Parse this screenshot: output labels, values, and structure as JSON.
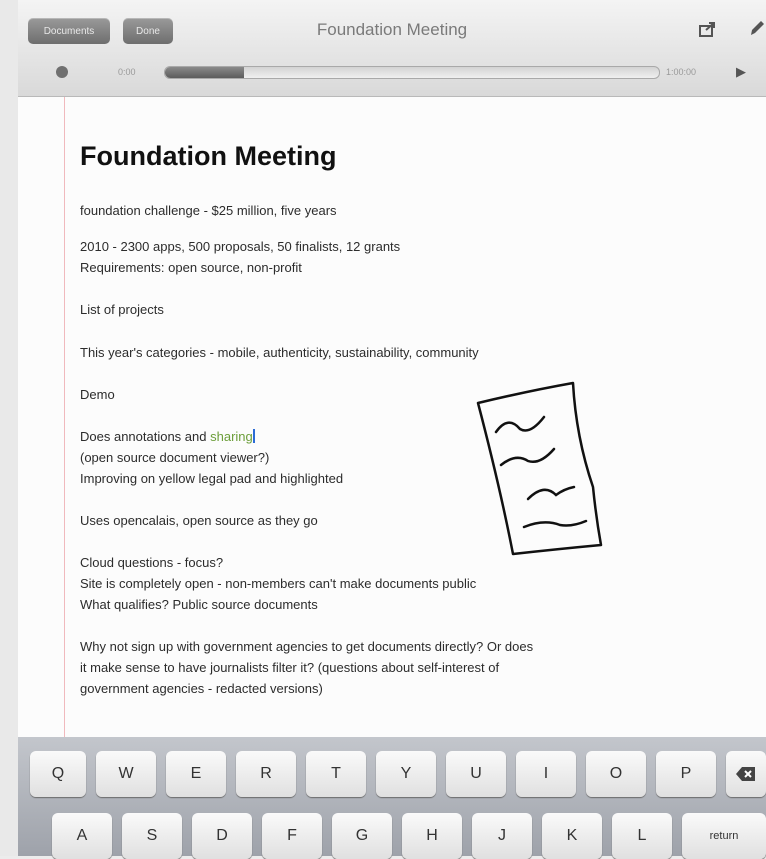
{
  "toolbar": {
    "title": "Foundation Meeting",
    "left_buttons": [
      "Documents",
      "Done"
    ],
    "share_icon": "share-icon",
    "pen_icon": "pen-icon",
    "play_icon": "play-icon",
    "elapsed": "0:00",
    "remaining": "1:00:00",
    "playback_progress": 0.16
  },
  "document": {
    "title": "Foundation Meeting",
    "lines": [
      {
        "text": "foundation challenge - $25 million, five years"
      },
      {
        "text": "2010 - 2300 apps, 500 proposals, 50 finalists, 12 grants"
      },
      {
        "text": "Requirements: open source, non-profit"
      },
      {
        "text": "List of projects"
      },
      {
        "text": "This year's categories - mobile, authenticity, sustainability, community"
      },
      {
        "text": "Demo"
      },
      {
        "text": "Does annotations and ",
        "highlight": "sharing"
      },
      {
        "text": "(open source document viewer?)"
      },
      {
        "text": "Improving on yellow legal pad and highlighted"
      },
      {
        "text": "Uses opencalais, open source as they go"
      },
      {
        "text": "Cloud questions - focus?"
      },
      {
        "text": "Site is completely open - non-members can't make documents public"
      },
      {
        "text": "What qualifies? Public source documents"
      },
      {
        "text": "Why not sign up with government agencies to get documents directly? Or does"
      },
      {
        "text": "it make sense to have journalists filter it? (questions about self-interest of"
      },
      {
        "text": "government agencies - redacted versions)"
      }
    ],
    "sketch_icon": "document-sketch-icon"
  },
  "keyboard": {
    "row1": [
      "Q",
      "W",
      "E",
      "R",
      "T",
      "Y",
      "U",
      "I",
      "O",
      "P"
    ],
    "backspace_icon": "backspace-icon",
    "row2": [
      "A",
      "S",
      "D",
      "F",
      "G",
      "H",
      "J",
      "K",
      "L"
    ],
    "return_label": "return"
  }
}
